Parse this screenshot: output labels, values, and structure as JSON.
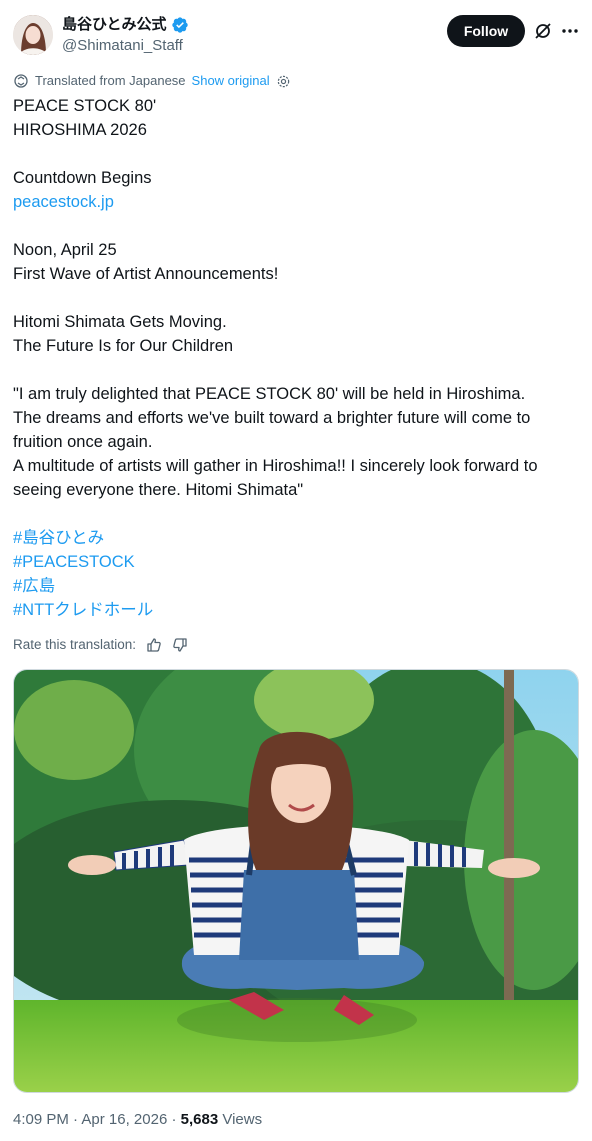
{
  "author": {
    "display_name": "島谷ひとみ公式",
    "handle": "@Shimatani_Staff",
    "verified": true,
    "verified_color": "#1d9bf0"
  },
  "header": {
    "follow_label": "Follow"
  },
  "translation": {
    "notice": "Translated from Japanese",
    "show_original": "Show original",
    "rate_label": "Rate this translation:"
  },
  "tweet": {
    "lines": {
      "l1": "PEACE STOCK 80'",
      "l2": "HIROSHIMA 2026",
      "l3": "Countdown Begins",
      "link": "peacestock.jp",
      "l4": "Noon, April 25",
      "l5": "First Wave of Artist Announcements!",
      "l6": "Hitomi Shimata Gets Moving.",
      "l7": "The Future Is for Our Children",
      "l8": "\"I am truly delighted that PEACE STOCK 80' will be held in Hiroshima.",
      "l9": "The dreams and efforts we've built toward a brighter future will come to",
      "l10": "fruition once again.",
      "l11": "A multitude of artists will gather in Hiroshima!! I sincerely look forward to",
      "l12": "seeing everyone there. Hitomi Shimata\""
    },
    "hashtags": [
      "#島谷ひとみ",
      "#PEACESTOCK",
      "#広島",
      "#NTTクレドホール"
    ]
  },
  "meta": {
    "time": "4:09 PM",
    "sep1": "·",
    "date": "Apr 16, 2026",
    "sep2": "·",
    "views_count": "5,683",
    "views_label": "Views"
  },
  "colors": {
    "link": "#1d9bf0",
    "text": "#0f1419",
    "muted": "#536471"
  }
}
